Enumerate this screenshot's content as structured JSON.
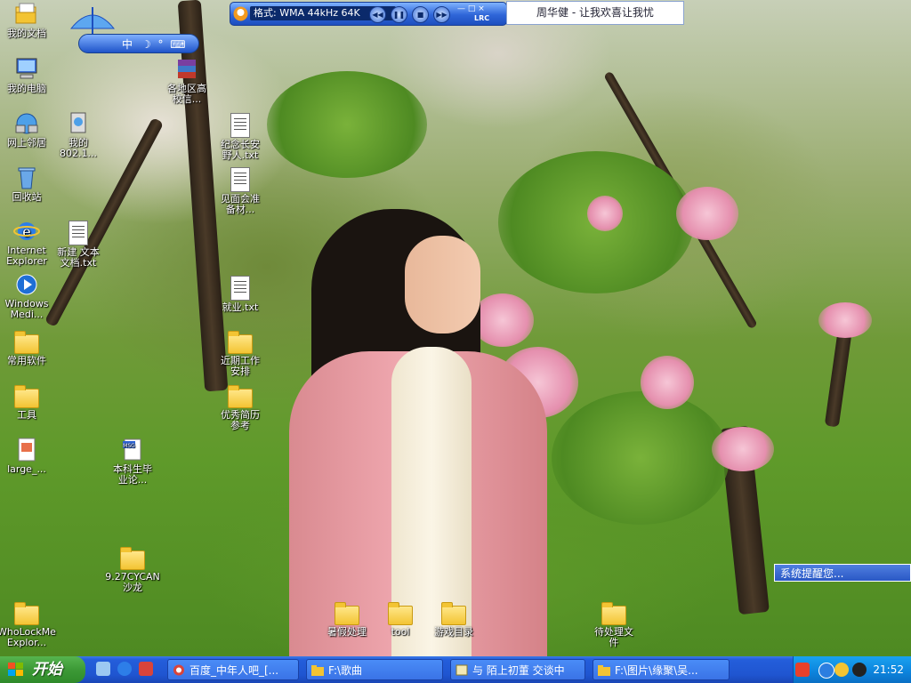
{
  "desktop_icons_left": [
    {
      "name": "my-documents",
      "label": "我的文档",
      "type": "folder-special"
    },
    {
      "name": "my-computer",
      "label": "我的电脑",
      "type": "computer"
    },
    {
      "name": "network",
      "label": "网上邻居",
      "type": "network"
    },
    {
      "name": "my-802",
      "label": "我的\n802.1...",
      "type": "network2"
    },
    {
      "name": "recycle-bin",
      "label": "回收站",
      "type": "recycle"
    },
    {
      "name": "internet-explorer",
      "label": "Internet\nExplorer",
      "type": "ie"
    },
    {
      "name": "new-text",
      "label": "新建 文本\n文档.txt",
      "type": "txt"
    },
    {
      "name": "windows-media",
      "label": "Windows\nMedi...",
      "type": "wmp"
    },
    {
      "name": "common-software",
      "label": "常用软件",
      "type": "folder"
    },
    {
      "name": "tools",
      "label": "工具",
      "type": "folder"
    },
    {
      "name": "large",
      "label": "large_...",
      "type": "file"
    },
    {
      "name": "undergrad",
      "label": "本科生毕\n业论...",
      "type": "msg"
    },
    {
      "name": "cycan",
      "label": "9.27CYCAN\n沙龙",
      "type": "folder"
    },
    {
      "name": "wholockme",
      "label": "WhoLockMe\nExplor...",
      "type": "folder"
    }
  ],
  "desktop_icons_middle": [
    {
      "name": "regional",
      "label": "各地区高\n校信...",
      "type": "rar"
    },
    {
      "name": "memorial",
      "label": "纪念长安\n野人.txt",
      "type": "txt"
    },
    {
      "name": "interview",
      "label": "见面会准\n备材...",
      "type": "txt"
    },
    {
      "name": "employment",
      "label": "就业.txt",
      "type": "txt"
    },
    {
      "name": "recent-work",
      "label": "近期工作\n安排",
      "type": "folder"
    },
    {
      "name": "resume",
      "label": "优秀简历\n参考",
      "type": "folder"
    }
  ],
  "desktop_icons_bottom": [
    {
      "name": "summer",
      "label": "暑假处理",
      "type": "folder"
    },
    {
      "name": "tool-folder",
      "label": "tool",
      "type": "folder"
    },
    {
      "name": "games",
      "label": "游戏目录",
      "type": "folder"
    },
    {
      "name": "pending",
      "label": "待处理文\n件",
      "type": "folder"
    }
  ],
  "media_player": {
    "format": "格式: WMA 44kHz 64K",
    "song": "周华健 - 让我欢喜让我忧",
    "lrc": "LRC"
  },
  "ime": {
    "label": "中"
  },
  "notification": {
    "text": "系统提醒您..."
  },
  "taskbar": {
    "start_label": "开始",
    "tasks": [
      {
        "label": "百度_中年人吧_[...",
        "icon": "ie-icon"
      },
      {
        "label": "F:\\歌曲",
        "icon": "folder-icon"
      },
      {
        "label": "与 陌上初董 交谈中",
        "icon": "chat-icon"
      },
      {
        "label": "F:\\图片\\缘聚\\吴...",
        "icon": "folder-icon"
      }
    ],
    "clock": "21:52"
  },
  "colors": {
    "taskbar": "#245edb",
    "start": "#3c9a36",
    "tray": "#0c83dc"
  }
}
